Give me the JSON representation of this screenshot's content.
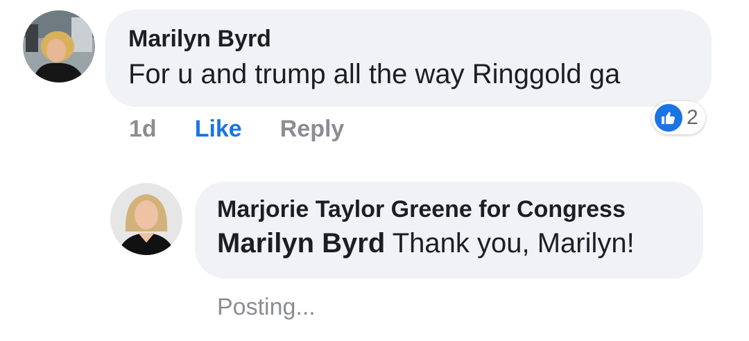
{
  "comment": {
    "author": "Marilyn Byrd",
    "text": "For u and trump all the way Ringgold ga",
    "timestamp": "1d",
    "like_label": "Like",
    "reply_label": "Reply",
    "reaction": {
      "icon": "thumbs-up-icon",
      "count": "2",
      "color": "#1b74e4"
    }
  },
  "reply": {
    "author": "Marjorie Taylor Greene for Congress",
    "mention": "Marilyn Byrd",
    "text": " Thank you, Marilyn!",
    "status": "Posting..."
  },
  "colors": {
    "bubble": "#f0f2f5",
    "link_blue": "#1b74e4",
    "muted": "#8a8d91",
    "text": "#1c1e21"
  }
}
